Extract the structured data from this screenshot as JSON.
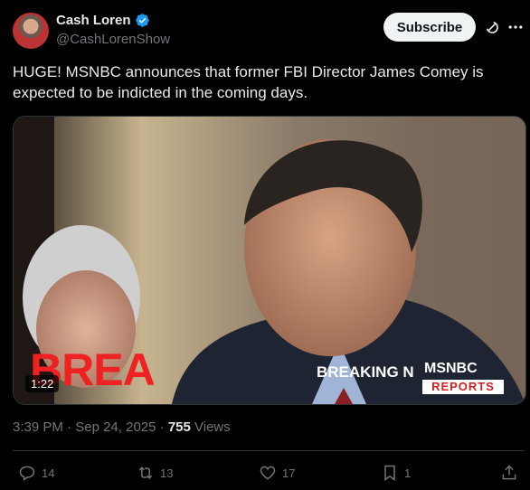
{
  "author": {
    "name": "Cash Loren",
    "handle": "@CashLorenShow",
    "verified": true
  },
  "header": {
    "subscribe_label": "Subscribe"
  },
  "tweet": {
    "text": "HUGE! MSNBC announces that former FBI Director James Comey is expected to be indicted in the coming days."
  },
  "media": {
    "duration": "1:22",
    "banner_big": "BREA",
    "banner_small": "BREAKING N",
    "network": "MSNBC",
    "network_sub": "REPORTS"
  },
  "meta": {
    "time": "3:39 PM",
    "date": "Sep 24, 2025",
    "views_count": "755",
    "views_label": "Views"
  },
  "actions": {
    "replies": "14",
    "reposts": "13",
    "likes": "17",
    "bookmarks": "1"
  },
  "colors": {
    "background": "#000000",
    "text": "#e7e9ea",
    "muted": "#71767b",
    "verified": "#1d9bf0",
    "breaking_red": "#e22222"
  }
}
